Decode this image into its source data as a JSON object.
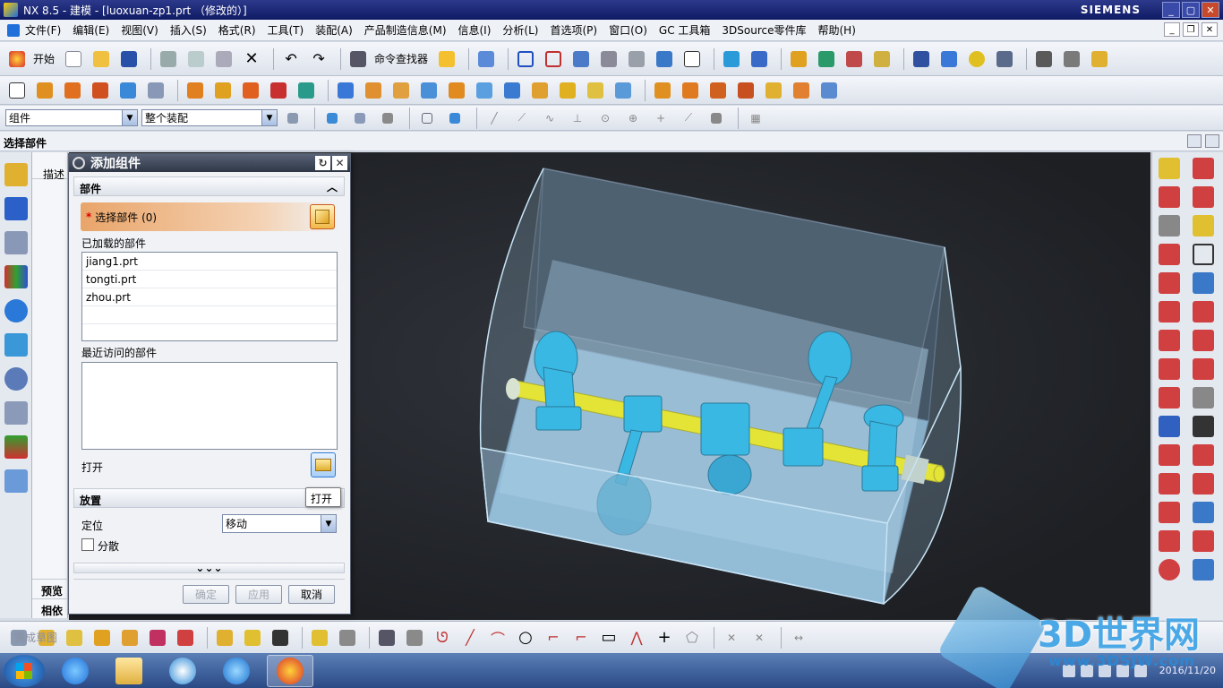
{
  "window": {
    "title": "NX 8.5 - 建模 - [luoxuan-zp1.prt （修改的）]",
    "brand": "SIEMENS"
  },
  "menubar": {
    "items": [
      "文件(F)",
      "编辑(E)",
      "视图(V)",
      "插入(S)",
      "格式(R)",
      "工具(T)",
      "装配(A)",
      "产品制造信息(M)",
      "信息(I)",
      "分析(L)",
      "首选项(P)",
      "窗口(O)",
      "GC 工具箱",
      "3DSource零件库",
      "帮助(H)"
    ]
  },
  "toolbar": {
    "start_label": "开始",
    "command_finder_label": "命令查找器"
  },
  "selection_bar": {
    "filter_value": "组件",
    "scope_value": "整个装配"
  },
  "cue_line": {
    "text": "选择部件"
  },
  "navigator": {
    "header": "描述",
    "bottom_tabs": [
      "预览",
      "相依"
    ]
  },
  "dialog": {
    "title": "添加组件",
    "part_section": {
      "label": "部件",
      "select_label": "选择部件 (0)",
      "loaded_label": "已加载的部件",
      "loaded_parts": [
        "jiang1.prt",
        "tongti.prt",
        "zhou.prt"
      ],
      "recent_label": "最近访问的部件",
      "recent_parts": [],
      "open_label": "打开",
      "tooltip": "打开"
    },
    "placement_section": {
      "label": "放置",
      "positioning_label": "定位",
      "positioning_value": "移动",
      "scatter_label": "分散",
      "scatter_checked": false
    },
    "more_indicator": "⌄⌄⌄",
    "buttons": {
      "ok": "确定",
      "apply": "应用",
      "cancel": "取消"
    }
  },
  "bottom_toolbar": {
    "finish_sketch_label": "完成草图"
  },
  "taskbar": {
    "date": "2016/11/20"
  },
  "watermark": {
    "title": "3D世界网",
    "url": "www.3DSJW.com"
  },
  "colors": {
    "shaft": "#f4e800",
    "components": "#1ab0e0",
    "housing": "#a8d4f0",
    "viewport_bg": "#23262b",
    "title_bar": "#0e1a63",
    "select_highlight": "#e9a56a"
  }
}
